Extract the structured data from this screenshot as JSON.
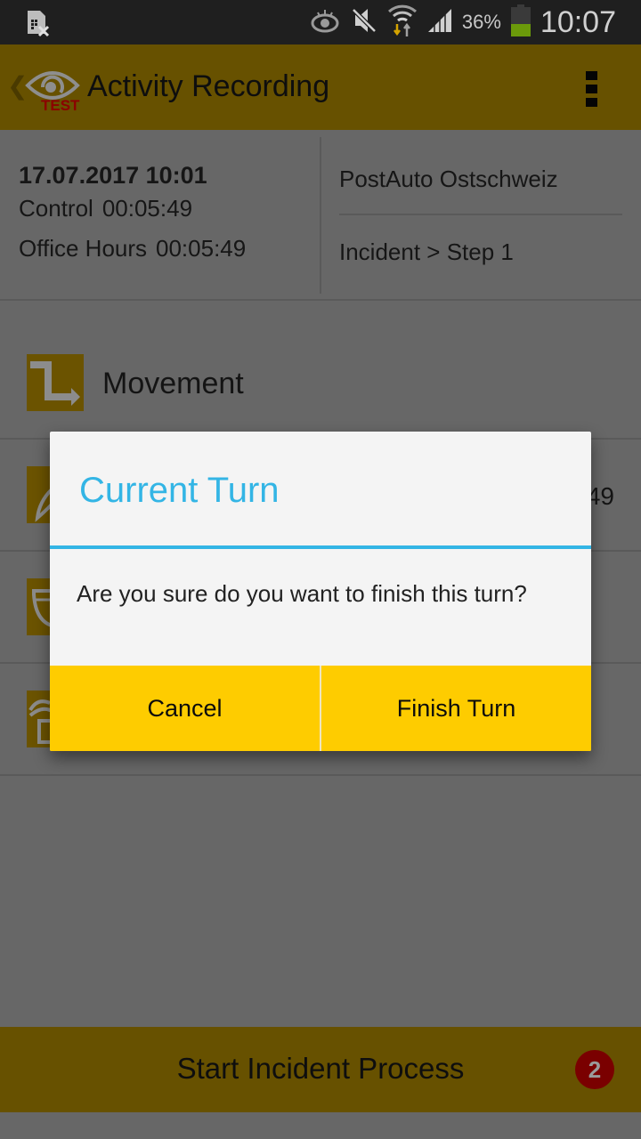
{
  "status_bar": {
    "icons": [
      "sim-card-error-icon",
      "eye-icon",
      "mute-icon",
      "wifi-icon",
      "signal-icon",
      "battery-icon"
    ],
    "battery_percent": "36%",
    "time": "10:07",
    "colors": {
      "battery_fill": "#6b9a0a",
      "wifi_down_arrow": "#d4a300"
    }
  },
  "app_bar": {
    "title": "Activity Recording",
    "logo_badge": "TEST",
    "icons": [
      "back-chevron-icon",
      "eye-logo-icon",
      "overflow-menu-icon"
    ],
    "colors": {
      "background": "#675100",
      "badge": "#8b0000"
    }
  },
  "info": {
    "date_time": "17.07.2017 10:01",
    "rows": [
      {
        "label": "Control",
        "value": "00:05:49"
      },
      {
        "label": "Office Hours",
        "value": "00:05:49"
      }
    ],
    "operator": "PostAuto Ostschweiz",
    "step": "Incident > Step 1"
  },
  "list": {
    "items": [
      {
        "icon": "movement-arrow-icon",
        "label": "Movement",
        "value": ""
      },
      {
        "icon": "pen-icon",
        "label": "",
        "value": "49"
      },
      {
        "icon": "cup-icon",
        "label": "",
        "value": ""
      },
      {
        "icon": "bed-icon",
        "label": "",
        "value": ""
      }
    ]
  },
  "bottom_bar": {
    "label": "Start Incident Process",
    "badge_count": "2"
  },
  "dialog": {
    "title": "Current Turn",
    "message": "Are you sure do you want to finish this turn?",
    "cancel_label": "Cancel",
    "confirm_label": "Finish Turn",
    "colors": {
      "title": "#33b5e5",
      "buttons": "#fecc00"
    }
  }
}
